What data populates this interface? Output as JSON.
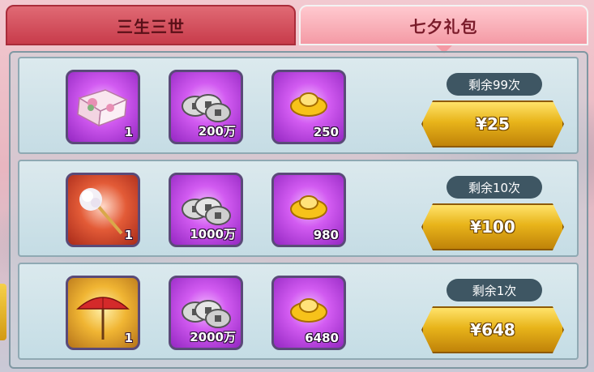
{
  "tabs": [
    {
      "label": "三生三世",
      "active": false
    },
    {
      "label": "七夕礼包",
      "active": true
    }
  ],
  "packs": [
    {
      "items": [
        {
          "icon": "lotus-book-icon",
          "count": "1",
          "frame": "purple"
        },
        {
          "icon": "coins-icon",
          "count": "200万",
          "frame": "purple"
        },
        {
          "icon": "gold-ingot-icon",
          "count": "250",
          "frame": "purple"
        }
      ],
      "remaining": "剩余99次",
      "price": "¥25"
    },
    {
      "items": [
        {
          "icon": "flower-hairpin-icon",
          "count": "1",
          "frame": "red"
        },
        {
          "icon": "coins-icon",
          "count": "1000万",
          "frame": "purple"
        },
        {
          "icon": "gold-ingot-icon",
          "count": "980",
          "frame": "purple"
        }
      ],
      "remaining": "剩余10次",
      "price": "¥100"
    },
    {
      "items": [
        {
          "icon": "red-umbrella-icon",
          "count": "1",
          "frame": "gold"
        },
        {
          "icon": "coins-icon",
          "count": "2000万",
          "frame": "purple"
        },
        {
          "icon": "gold-ingot-icon",
          "count": "6480",
          "frame": "purple"
        }
      ],
      "remaining": "剩余1次",
      "price": "¥648"
    }
  ],
  "colors": {
    "tab_inactive": "#c83c4b",
    "tab_active": "#f49aa5",
    "button_gold": "#e8b41a",
    "badge_bg": "#3e5663",
    "item_purple": "#d25bf1"
  }
}
